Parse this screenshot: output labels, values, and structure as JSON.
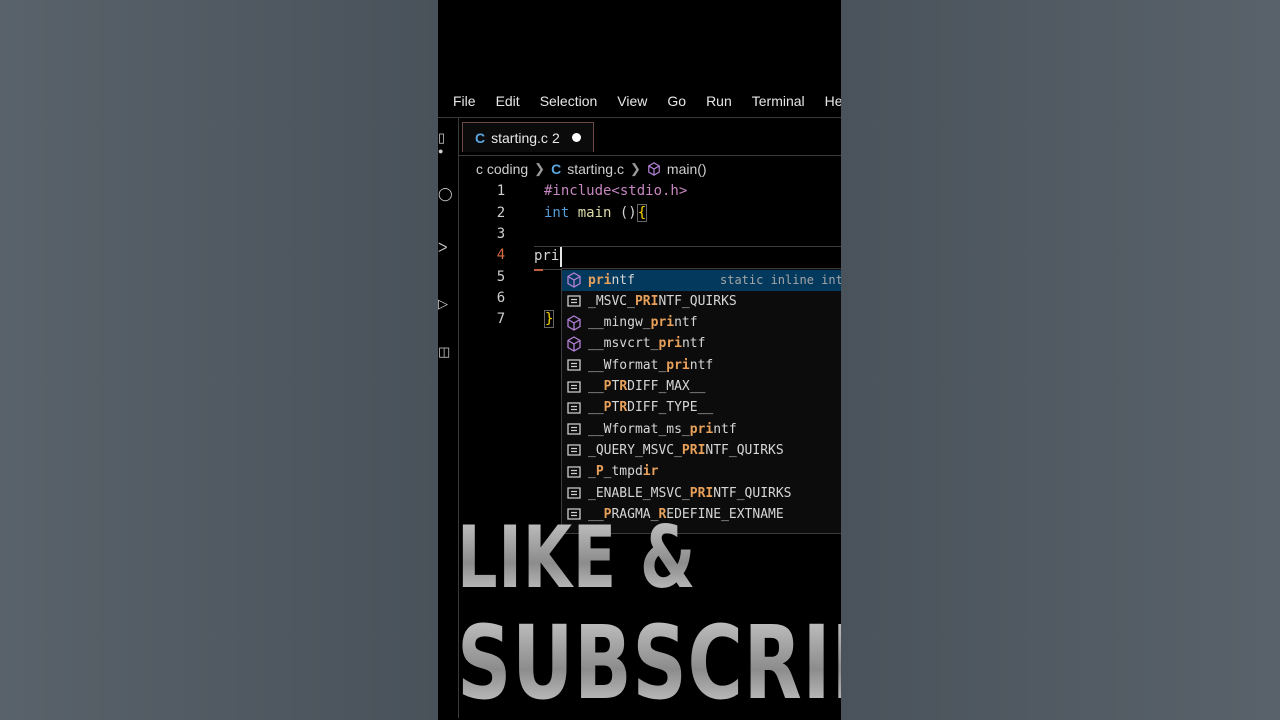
{
  "menu": [
    "File",
    "Edit",
    "Selection",
    "View",
    "Go",
    "Run",
    "Terminal",
    "Help"
  ],
  "tab": {
    "icon": "c-language-icon",
    "icon_glyph": "C",
    "filename": "starting.c",
    "problems": "2"
  },
  "breadcrumb": {
    "folder": "c coding",
    "file": "starting.c",
    "symbol": "main()"
  },
  "editor": {
    "line_numbers": [
      "1",
      "2",
      "3",
      "4",
      "5",
      "6",
      "7"
    ],
    "line1": "#include<stdio.h>",
    "line2_kw": "int",
    "line2_fn": "main",
    "line2_rest": " ()",
    "line2_brace": "{",
    "line4_typed": "pri",
    "line7_brace": "}"
  },
  "suggestions": [
    {
      "pre": "",
      "match": "pri",
      "post": "ntf",
      "kind": "method",
      "detail": "static inline int"
    },
    {
      "pre": "_MSVC_",
      "match": "PRI",
      "post": "NTF_QUIRKS",
      "kind": "constant"
    },
    {
      "pre": "__mingw_",
      "match": "pri",
      "post": "ntf",
      "kind": "method"
    },
    {
      "pre": "__msvcrt_",
      "match": "pri",
      "post": "ntf",
      "kind": "method"
    },
    {
      "pre": "__Wformat_",
      "match": "pri",
      "post": "ntf",
      "kind": "constant"
    },
    {
      "pre": "__",
      "match": "P",
      "post": "T",
      "match2": "R",
      "post2": "DIFF_MAX__",
      "kind": "constant"
    },
    {
      "pre": "__",
      "match": "P",
      "post": "T",
      "match2": "R",
      "post2": "DIFF_TYPE__",
      "kind": "constant"
    },
    {
      "pre": "__Wformat_ms_",
      "match": "pri",
      "post": "ntf",
      "kind": "constant"
    },
    {
      "pre": "_QUERY_MSVC_",
      "match": "PRI",
      "post": "NTF_QUIRKS",
      "kind": "constant"
    },
    {
      "pre": "_",
      "match": "P",
      "post": "_tmpd",
      "match2": "ir",
      "post2": "",
      "kind": "constant"
    },
    {
      "pre": "_ENABLE_MSVC_",
      "match": "PRI",
      "post": "NTF_QUIRKS",
      "kind": "constant"
    },
    {
      "pre": "__",
      "match": "P",
      "post": "RAGMA_",
      "match2": "R",
      "post2": "EDEFINE_EXTNAME",
      "kind": "constant"
    }
  ],
  "overlay": {
    "line1": "LIKE &",
    "line2": "SUBSCRIBE"
  },
  "colors": {
    "accent_match": "#e8a05a",
    "keyword": "#569cd6",
    "preprocessor": "#c586c0",
    "selected_row": "#04395e"
  }
}
